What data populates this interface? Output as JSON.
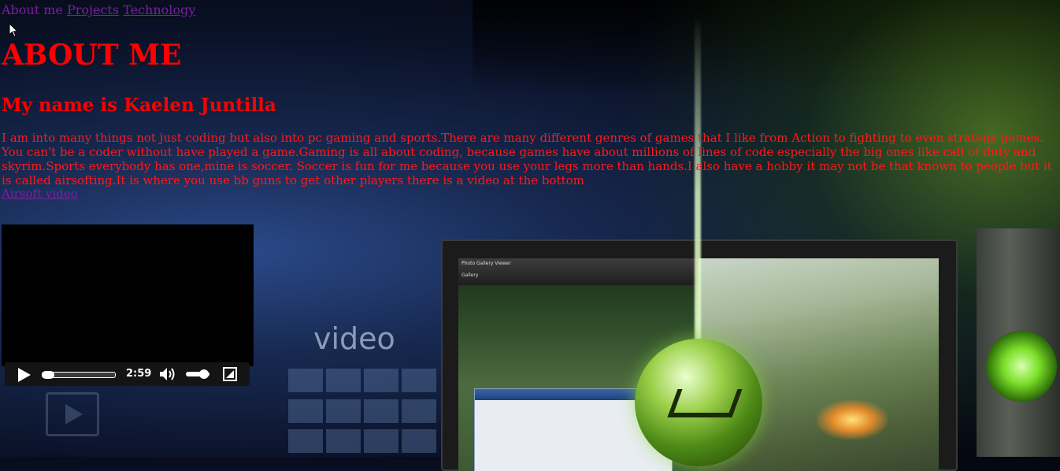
{
  "nav": {
    "current": "About me",
    "links": [
      "Projects",
      "Technology"
    ]
  },
  "page_title": "ABOUT ME",
  "name_heading": "My name is Kaelen Juntilla",
  "bio": "I am into many things not just coding but also into pc gaming and sports.There are many different genres of games that I like from Action to fighting to even strategy games. You can't be a coder without have played a game.Gaming is all about coding, because games have about millions of lines of code especially the big ones like call of duty and skyrim.Sports everybody has one,mine is soccer. Soccer is fun for me because you use your legs more than hands.I also have a hobby it may not be that known to people but it is called airsofting.It is where you use bb guns to get other players there is a video at the bottom",
  "video_link": "Airsoft video",
  "video_player": {
    "duration": "2:59",
    "progress": 0.0,
    "volume": 0.75
  },
  "background": {
    "word": "video",
    "screen_title": "Photo Gallery Viewer",
    "screen_gallery_label": "Gallery"
  },
  "colors": {
    "heading": "#ff0000",
    "link": "#7b1fa2",
    "body_text": "#ff1a1a"
  }
}
